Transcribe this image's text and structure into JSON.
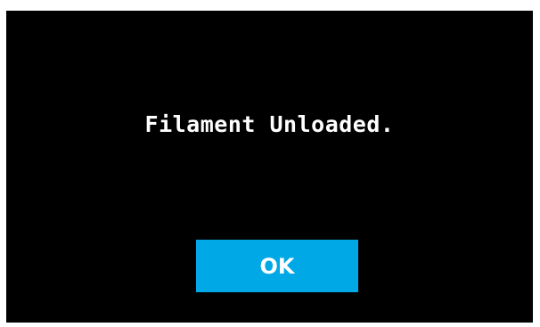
{
  "dialog": {
    "message": "Filament Unloaded.",
    "ok_label": "OK"
  },
  "colors": {
    "background": "#000000",
    "text": "#ffffff",
    "accent": "#00a8e6"
  }
}
